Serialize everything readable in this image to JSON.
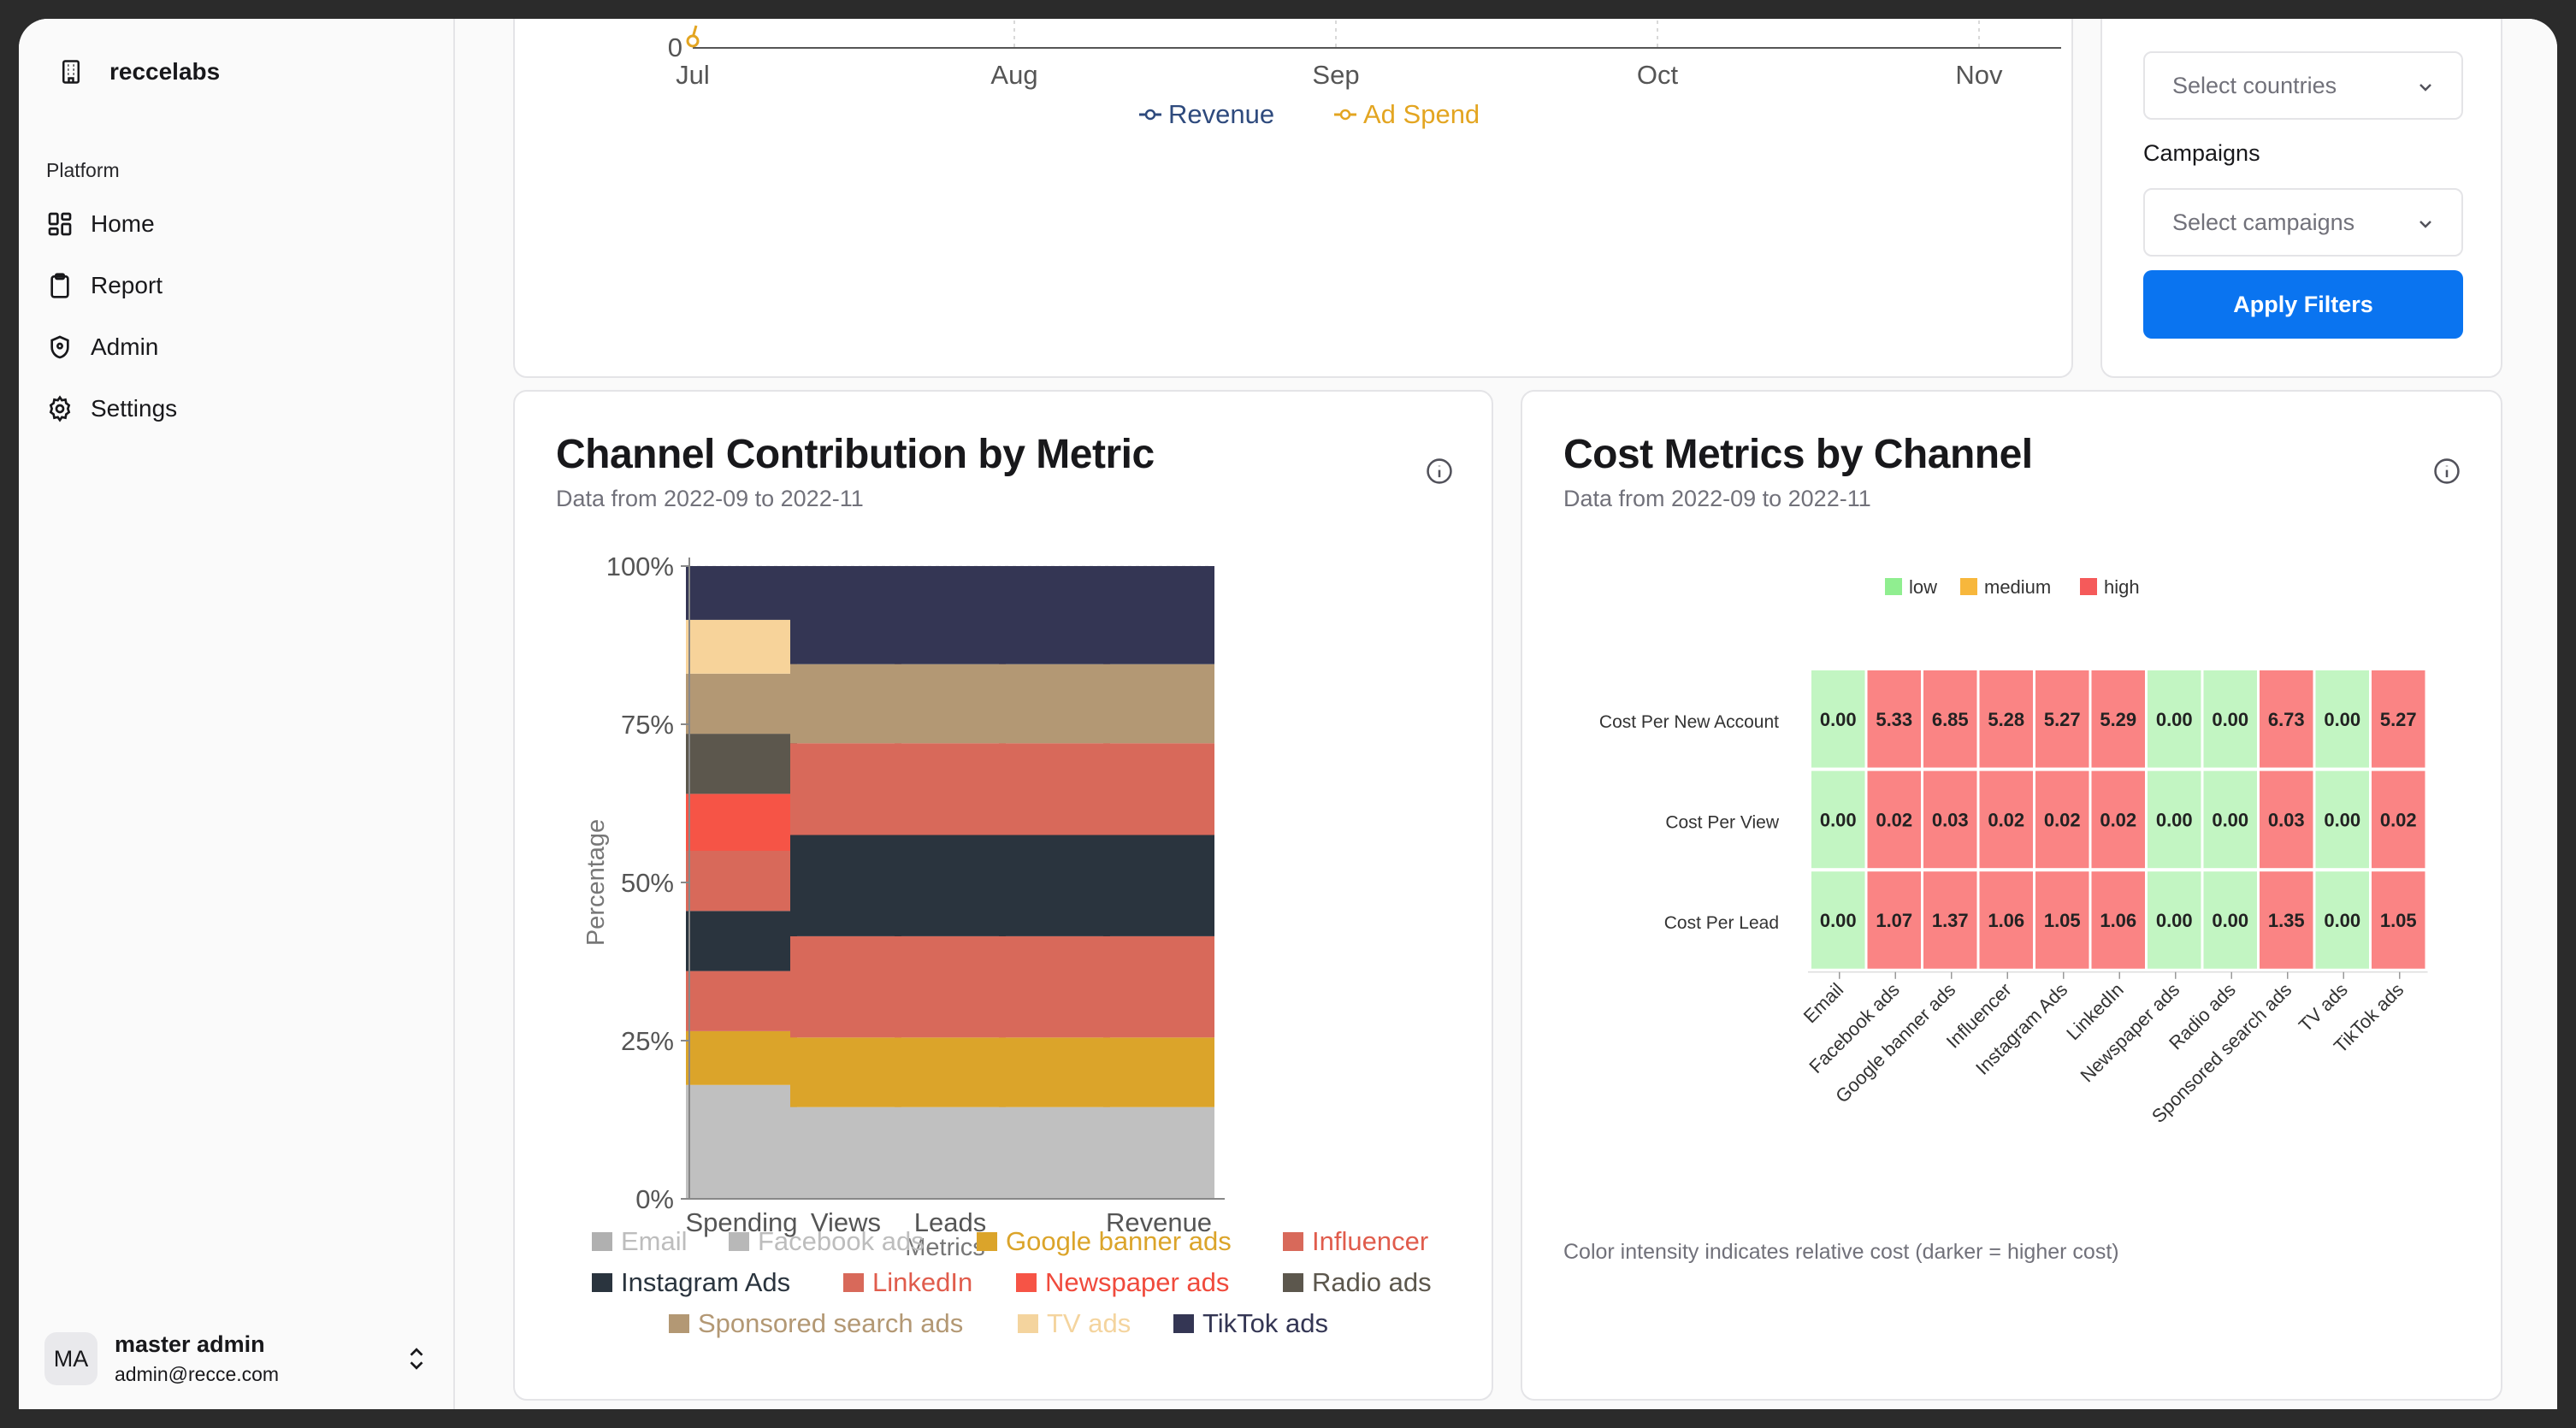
{
  "app": {
    "name": "reccelabs"
  },
  "sidebar": {
    "group_label": "Platform",
    "items": [
      {
        "label": "Home",
        "icon": "dashboard-icon"
      },
      {
        "label": "Report",
        "icon": "clipboard-icon"
      },
      {
        "label": "Admin",
        "icon": "shield-icon"
      },
      {
        "label": "Settings",
        "icon": "gear-icon"
      }
    ],
    "user": {
      "initials": "MA",
      "name": "master admin",
      "email": "admin@recce.com"
    }
  },
  "top_chart": {
    "x_ticks": [
      "Jul",
      "Aug",
      "Sep",
      "Oct",
      "Nov"
    ],
    "y_tick": "0",
    "legend": [
      {
        "name": "Revenue",
        "color": "#2e4a7d"
      },
      {
        "name": "Ad Spend",
        "color": "#e3a521"
      }
    ]
  },
  "filters": {
    "countries_placeholder": "Select countries",
    "campaigns_label": "Campaigns",
    "campaigns_placeholder": "Select campaigns",
    "apply_label": "Apply Filters"
  },
  "channel_card": {
    "title": "Channel Contribution by Metric",
    "subtitle": "Data from 2022-09 to 2022-11"
  },
  "cost_card": {
    "title": "Cost Metrics by Channel",
    "subtitle": "Data from 2022-09 to 2022-11",
    "footnote": "Color intensity indicates relative cost (darker = higher cost)"
  },
  "chart_data": [
    {
      "type": "bar",
      "stacked": "percent",
      "xlabel": "Metrics",
      "ylabel": "Percentage",
      "y_ticks": [
        "0%",
        "25%",
        "50%",
        "75%",
        "100%"
      ],
      "ylim": [
        0,
        100
      ],
      "categories": [
        "Spending",
        "Views",
        "Leads",
        "Revenue",
        "Revenue"
      ],
      "x_tick_labels": [
        "Spending",
        "Views",
        "Leads",
        "",
        "Revenue"
      ],
      "legend_placement": "bottom",
      "series": [
        {
          "name": "Email",
          "color": "#c0c0c0",
          "values": [
            18,
            14.5,
            14.5,
            14.5,
            14.5
          ]
        },
        {
          "name": "Facebook ads",
          "color": "#c8c8c8",
          "values": [
            0,
            0,
            0,
            0,
            0
          ]
        },
        {
          "name": "Google banner ads",
          "color": "#dba42a",
          "values": [
            8.5,
            11,
            11,
            11,
            11
          ]
        },
        {
          "name": "Influencer",
          "color": "#d8695a",
          "values": [
            9.5,
            0,
            0,
            0,
            0
          ]
        },
        {
          "name": "Instagram Ads",
          "color": "#2a343e",
          "values": [
            9.5,
            0,
            0,
            0,
            0
          ]
        },
        {
          "name": "LinkedIn",
          "color": "#d8695a",
          "values": [
            9.5,
            16,
            16,
            16,
            16
          ]
        },
        {
          "name": "Newspaper ads",
          "color": "#f65446",
          "values": [
            9,
            0,
            0,
            0,
            0
          ]
        },
        {
          "name": "Radio ads",
          "color": "#5c574d",
          "values": [
            9.5,
            0,
            0,
            0,
            0
          ]
        },
        {
          "name": "Sponsored search ads",
          "color": "#b39874",
          "values": [
            9.5,
            12.5,
            12.5,
            12.5,
            12.5
          ]
        },
        {
          "name": "TV ads",
          "color": "#f7d39a",
          "values": [
            8.5,
            0,
            0,
            0,
            0
          ]
        },
        {
          "name": "TikTok ads",
          "color": "#343654",
          "values": [
            8.5,
            15.5,
            15.5,
            15.5,
            15.5
          ]
        }
      ],
      "extra_segments_note": "",
      "extra_series": [
        {
          "name": "Instagram Ads",
          "color": "#2a343e",
          "values": [
            0,
            16,
            16,
            16,
            16
          ]
        },
        {
          "name": "Influencer",
          "color": "#d8695a",
          "values": [
            0,
            14.5,
            14.5,
            14.5,
            14.5
          ]
        }
      ]
    },
    {
      "type": "heatmap",
      "legend": [
        {
          "name": "low",
          "color": "#90ee90"
        },
        {
          "name": "medium",
          "color": "#f7b73c"
        },
        {
          "name": "high",
          "color": "#f55a5a"
        }
      ],
      "rows": [
        "Cost Per New Account",
        "Cost Per View",
        "Cost Per Lead"
      ],
      "columns": [
        "Email",
        "Facebook ads",
        "Google banner ads",
        "Influencer",
        "Instagram Ads",
        "LinkedIn",
        "Newspaper ads",
        "Radio ads",
        "Sponsored search ads",
        "TV ads",
        "TikTok ads"
      ],
      "values": [
        [
          "0.00",
          "5.33",
          "6.85",
          "5.28",
          "5.27",
          "5.29",
          "0.00",
          "0.00",
          "6.73",
          "0.00",
          "5.27"
        ],
        [
          "0.00",
          "0.02",
          "0.03",
          "0.02",
          "0.02",
          "0.02",
          "0.00",
          "0.00",
          "0.03",
          "0.00",
          "0.02"
        ],
        [
          "0.00",
          "1.07",
          "1.37",
          "1.06",
          "1.05",
          "1.06",
          "0.00",
          "0.00",
          "1.35",
          "0.00",
          "1.05"
        ]
      ],
      "low_color": "#c2f5c2",
      "high_color": "#fa8484"
    }
  ]
}
